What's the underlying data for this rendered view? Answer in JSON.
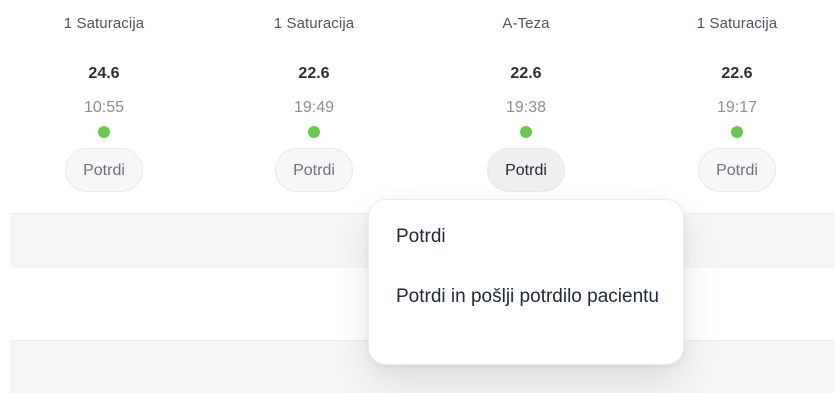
{
  "cards": [
    {
      "service": "1 Saturacija",
      "value": "24.6",
      "time": "10:55",
      "button_label": "Potrdi",
      "status_color": "#6cc751"
    },
    {
      "service": "1 Saturacija",
      "value": "22.6",
      "time": "19:49",
      "button_label": "Potrdi",
      "status_color": "#6cc751"
    },
    {
      "service": "A-Teza",
      "value": "22.6",
      "time": "19:38",
      "button_label": "Potrdi",
      "status_color": "#6cc751"
    },
    {
      "service": "1 Saturacija",
      "value": "22.6",
      "time": "19:17",
      "button_label": "Potrdi",
      "status_color": "#6cc751"
    }
  ],
  "menu": {
    "items": [
      {
        "label": "Potrdi"
      },
      {
        "label": "Potrdi in pošlji potrdilo pacientu"
      }
    ]
  }
}
